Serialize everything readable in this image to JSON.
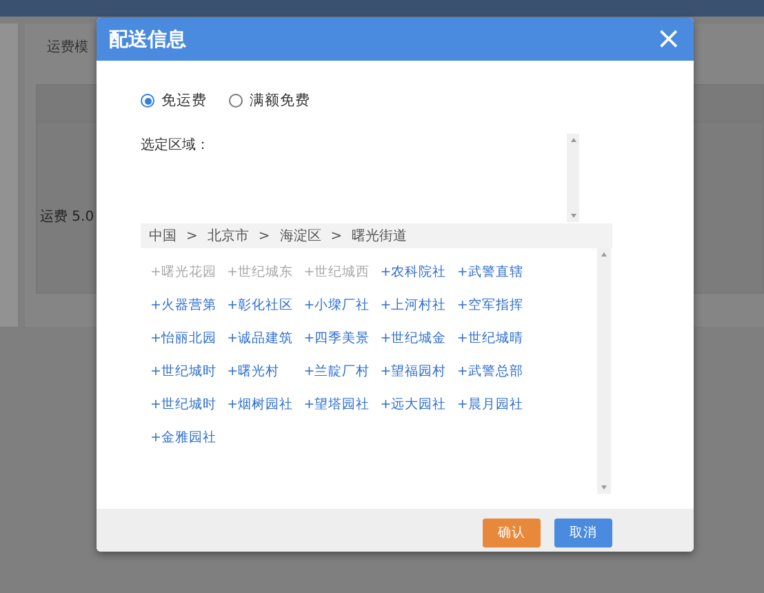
{
  "background": {
    "tab_label": "运费模",
    "row_text": "运费 5.0"
  },
  "dialog": {
    "title": "配送信息",
    "close": "×",
    "options": [
      {
        "label": "免运费",
        "selected": true
      },
      {
        "label": "满额免费",
        "selected": false
      }
    ],
    "region_label": "选定区域：",
    "breadcrumb": [
      "中国",
      "北京市",
      "海淀区",
      "曙光街道"
    ],
    "separator": ">",
    "areas": [
      {
        "label": "+曙光花园",
        "disabled": true
      },
      {
        "label": "+世纪城东",
        "disabled": true
      },
      {
        "label": "+世纪城西",
        "disabled": true
      },
      {
        "label": "+农科院社",
        "disabled": false
      },
      {
        "label": "+武警直辖",
        "disabled": false
      },
      {
        "label": "+火器营第",
        "disabled": false
      },
      {
        "label": "+彰化社区",
        "disabled": false
      },
      {
        "label": "+小墚厂社",
        "disabled": false
      },
      {
        "label": "+上河村社",
        "disabled": false
      },
      {
        "label": "+空军指挥",
        "disabled": false
      },
      {
        "label": "+怡丽北园",
        "disabled": false
      },
      {
        "label": "+诚品建筑",
        "disabled": false
      },
      {
        "label": "+四季美景",
        "disabled": false
      },
      {
        "label": "+世纪城金",
        "disabled": false
      },
      {
        "label": "+世纪城晴",
        "disabled": false
      },
      {
        "label": "+世纪城时",
        "disabled": false
      },
      {
        "label": "+曙光村",
        "disabled": false
      },
      {
        "label": "+兰靛厂村",
        "disabled": false
      },
      {
        "label": "+望福园村",
        "disabled": false
      },
      {
        "label": "+武警总部",
        "disabled": false
      },
      {
        "label": "+世纪城时",
        "disabled": false
      },
      {
        "label": "+烟树园社",
        "disabled": false
      },
      {
        "label": "+望塔园社",
        "disabled": false
      },
      {
        "label": "+远大园社",
        "disabled": false
      },
      {
        "label": "+晨月园社",
        "disabled": false
      },
      {
        "label": "+金雅园社",
        "disabled": false
      }
    ],
    "buttons": [
      {
        "label": "确认",
        "kind": "primary"
      },
      {
        "label": "取消",
        "kind": "secondary"
      }
    ]
  }
}
